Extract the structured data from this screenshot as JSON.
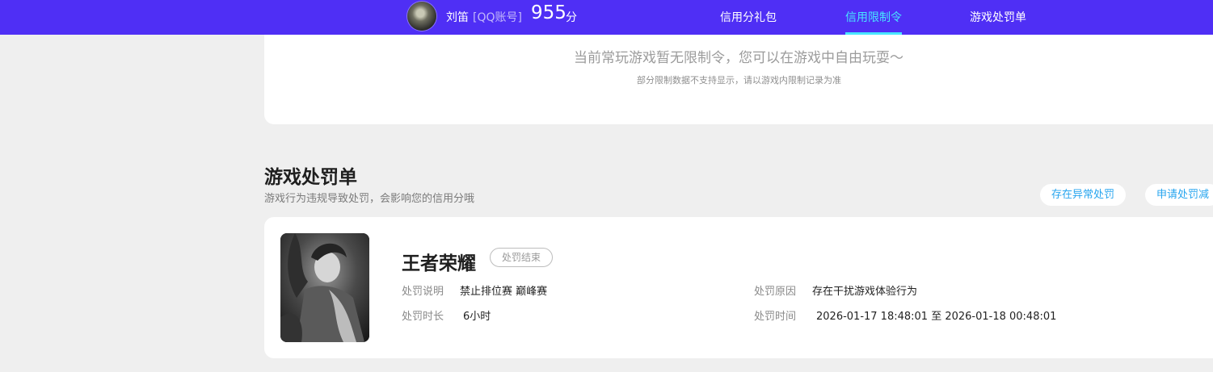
{
  "header": {
    "username": "刘笛",
    "account_type": "[QQ账号]",
    "score": "955",
    "score_unit": "分",
    "nav": [
      {
        "label": "信用分礼包",
        "active": false
      },
      {
        "label": "信用限制令",
        "active": true
      },
      {
        "label": "游戏处罚单",
        "active": false
      }
    ],
    "accent_color": "#48e6ff",
    "bar_color": "#4f2ff5"
  },
  "restriction": {
    "message": "当前常玩游戏暂无限制令，您可以在游戏中自由玩耍～",
    "note": "部分限制数据不支持显示，请以游戏内限制记录为准"
  },
  "penalty_section": {
    "title": "游戏处罚单",
    "subtitle": "游戏行为违规导致处罚，会影响您的信用分哦",
    "buttons": [
      "存在异常处罚",
      "申请处罚减"
    ]
  },
  "penalty": {
    "game": "王者荣耀",
    "status": "处罚结束",
    "desc_label": "处罚说明",
    "desc_value": "禁止排位赛 巅峰赛",
    "duration_label": "处罚时长",
    "duration_value": "6小时",
    "reason_label": "处罚原因",
    "reason_value": "存在干扰游戏体验行为",
    "time_label": "处罚时间",
    "time_value": "2026-01-17 18:48:01 至 2026-01-18 00:48:01"
  }
}
